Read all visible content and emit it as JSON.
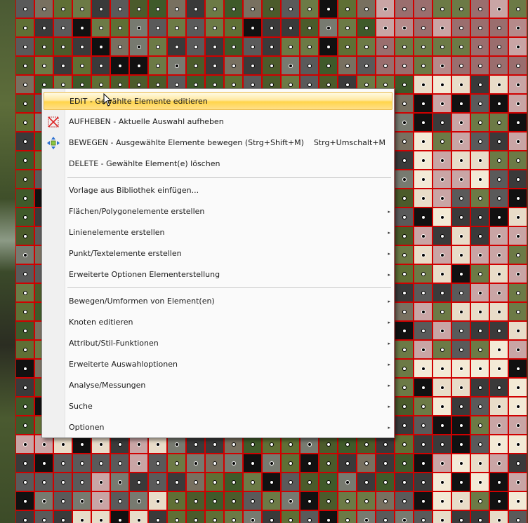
{
  "background": {
    "grid_border_color": "#d00000",
    "cell_palette": [
      "#4b5b2b",
      "#5f6f35",
      "#6c7a46",
      "#3a3a3a",
      "#5a5a5a",
      "#787060",
      "#9a6e6e",
      "#b58a8a",
      "#c9a5a5",
      "#e8dcc8",
      "#f3ead6",
      "#111111",
      "#777a70",
      "#3f5a2a"
    ]
  },
  "context_menu": {
    "items": [
      {
        "label": "EDIT - Gewählte Elemente editieren",
        "icon": "none",
        "highlighted": true
      },
      {
        "label": "AUFHEBEN - Aktuelle Auswahl aufheben",
        "icon": "cancel-selection-icon"
      },
      {
        "label": "BEWEGEN - Ausgewählte Elemente bewegen (Strg+Shift+M)",
        "icon": "move-arrows-icon",
        "shortcut": "Strg+Umschalt+M"
      },
      {
        "label": "DELETE - Gewählte Element(e) löschen",
        "icon": "none"
      },
      {
        "label": "Vorlage aus Bibliothek einfügen...",
        "icon": "none"
      },
      {
        "label": "Flächen/Polygonelemente erstellen",
        "submenu": true
      },
      {
        "label": "Linienelemente erstellen",
        "submenu": true
      },
      {
        "label": "Punkt/Textelemente erstellen",
        "submenu": true
      },
      {
        "label": "Erweiterte Optionen Elementerstellung",
        "submenu": true
      },
      {
        "label": "Bewegen/Umformen von Element(en)",
        "submenu": true
      },
      {
        "label": "Knoten editieren",
        "submenu": true
      },
      {
        "label": "Attribut/Stil-Funktionen",
        "submenu": true
      },
      {
        "label": "Erweiterte Auswahloptionen",
        "submenu": true
      },
      {
        "label": "Analyse/Messungen",
        "submenu": true
      },
      {
        "label": "Suche",
        "submenu": true
      },
      {
        "label": "Optionen",
        "submenu": true
      }
    ],
    "highlight_color": "#ffd44a",
    "submenu_arrow": "▸"
  }
}
